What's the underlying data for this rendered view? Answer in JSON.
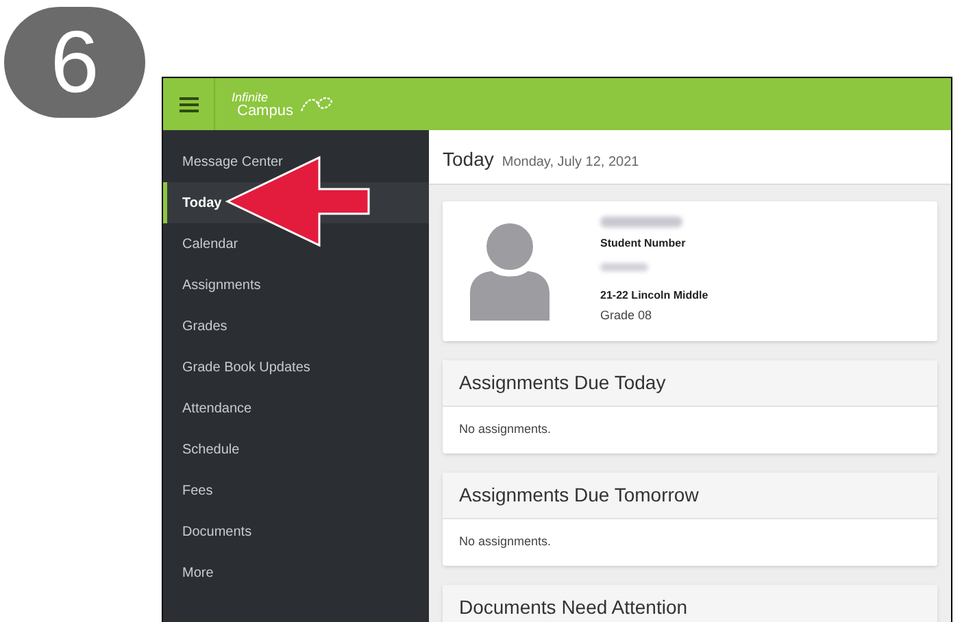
{
  "step": "6",
  "topbar": {
    "logo_top": "Infinite",
    "logo_bottom": "Campus"
  },
  "sidebar": {
    "items": [
      {
        "label": "Message Center",
        "selected": false
      },
      {
        "label": "Today",
        "selected": true
      },
      {
        "label": "Calendar",
        "selected": false
      },
      {
        "label": "Assignments",
        "selected": false
      },
      {
        "label": "Grades",
        "selected": false
      },
      {
        "label": "Grade Book Updates",
        "selected": false
      },
      {
        "label": "Attendance",
        "selected": false
      },
      {
        "label": "Schedule",
        "selected": false
      },
      {
        "label": "Fees",
        "selected": false
      },
      {
        "label": "Documents",
        "selected": false
      },
      {
        "label": "More",
        "selected": false
      }
    ]
  },
  "header": {
    "title": "Today",
    "date": "Monday, July 12, 2021"
  },
  "student": {
    "number_label": "Student Number",
    "school": "21-22 Lincoln Middle",
    "grade": "Grade 08"
  },
  "sections": [
    {
      "title": "Assignments Due Today",
      "body": "No assignments."
    },
    {
      "title": "Assignments Due Tomorrow",
      "body": "No assignments."
    },
    {
      "title": "Documents Need Attention"
    }
  ]
}
